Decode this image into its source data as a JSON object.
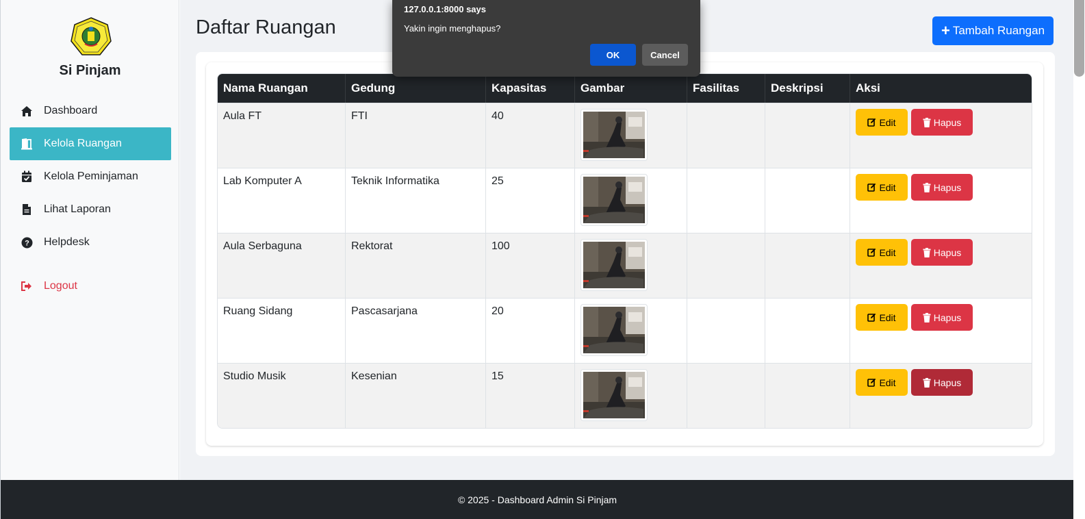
{
  "sidebar": {
    "brand": "Si Pinjam",
    "logo": "university-seal",
    "items": [
      {
        "label": "Dashboard",
        "icon": "home-icon"
      },
      {
        "label": "Kelola Ruangan",
        "icon": "door-icon",
        "active": true
      },
      {
        "label": "Kelola Peminjaman",
        "icon": "calendar-check-icon"
      },
      {
        "label": "Lihat Laporan",
        "icon": "file-icon"
      },
      {
        "label": "Helpdesk",
        "icon": "question-circle-icon"
      }
    ],
    "logout": {
      "label": "Logout",
      "icon": "sign-out-icon"
    }
  },
  "main": {
    "title": "Daftar Ruangan",
    "add_button": "Tambah Ruangan",
    "table": {
      "headers": [
        "Nama Ruangan",
        "Gedung",
        "Kapasitas",
        "Gambar",
        "Fasilitas",
        "Deskripsi",
        "Aksi"
      ],
      "rows": [
        {
          "nama": "Aula FT",
          "gedung": "FTI",
          "kapasitas": "40",
          "fasilitas": "",
          "deskripsi": ""
        },
        {
          "nama": "Lab Komputer A",
          "gedung": "Teknik Informatika",
          "kapasitas": "25",
          "fasilitas": "",
          "deskripsi": ""
        },
        {
          "nama": "Aula Serbaguna",
          "gedung": "Rektorat",
          "kapasitas": "100",
          "fasilitas": "",
          "deskripsi": ""
        },
        {
          "nama": "Ruang Sidang",
          "gedung": "Pascasarjana",
          "kapasitas": "20",
          "fasilitas": "",
          "deskripsi": ""
        },
        {
          "nama": "Studio Musik",
          "gedung": "Kesenian",
          "kapasitas": "15",
          "fasilitas": "",
          "deskripsi": ""
        }
      ],
      "edit_label": "Edit",
      "delete_label": "Hapus"
    }
  },
  "footer": {
    "text": "© 2025 - Dashboard Admin Si Pinjam"
  },
  "dialog": {
    "title": "127.0.0.1:8000 says",
    "message": "Yakin ingin menghapus?",
    "ok": "OK",
    "cancel": "Cancel"
  },
  "colors": {
    "accent": "#3bb6c6",
    "primary": "#0d6efd",
    "warning": "#ffc107",
    "danger": "#dc3545"
  }
}
